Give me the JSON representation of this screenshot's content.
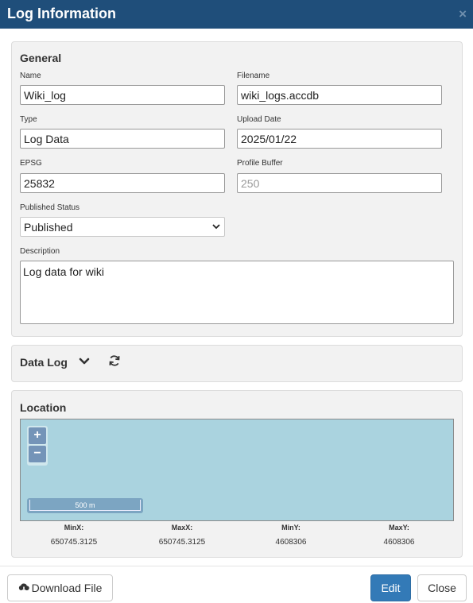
{
  "dialog": {
    "title": "Log Information",
    "close_glyph": "×"
  },
  "general": {
    "heading": "General",
    "name_label": "Name",
    "name_value": "Wiki_log",
    "filename_label": "Filename",
    "filename_value": "wiki_logs.accdb",
    "type_label": "Type",
    "type_value": "Log Data",
    "upload_date_label": "Upload Date",
    "upload_date_value": "2025/01/22",
    "epsg_label": "EPSG",
    "epsg_value": "25832",
    "profile_buffer_label": "Profile Buffer",
    "profile_buffer_placeholder": "250",
    "published_status_label": "Published Status",
    "published_status_value": "Published",
    "description_label": "Description",
    "description_value": "Log data for wiki"
  },
  "data_log": {
    "heading": "Data Log",
    "chevron_icon": "chevron-down-icon",
    "refresh_icon": "refresh-icon"
  },
  "location": {
    "heading": "Location",
    "map": {
      "zoom_in": "+",
      "zoom_out": "−",
      "scale_label": "500 m",
      "water_color": "#aad3df"
    },
    "extent": [
      {
        "label": "MinX:",
        "value": "650745.3125"
      },
      {
        "label": "MaxX:",
        "value": "650745.3125"
      },
      {
        "label": "MinY:",
        "value": "4608306"
      },
      {
        "label": "MaxY:",
        "value": "4608306"
      }
    ]
  },
  "footer": {
    "download_label": "Download File",
    "download_icon": "cloud-download-icon",
    "edit_label": "Edit",
    "close_label": "Close"
  },
  "colors": {
    "header": "#1f4e7a",
    "primary": "#337ab7",
    "panel": "#f2f2f2"
  }
}
